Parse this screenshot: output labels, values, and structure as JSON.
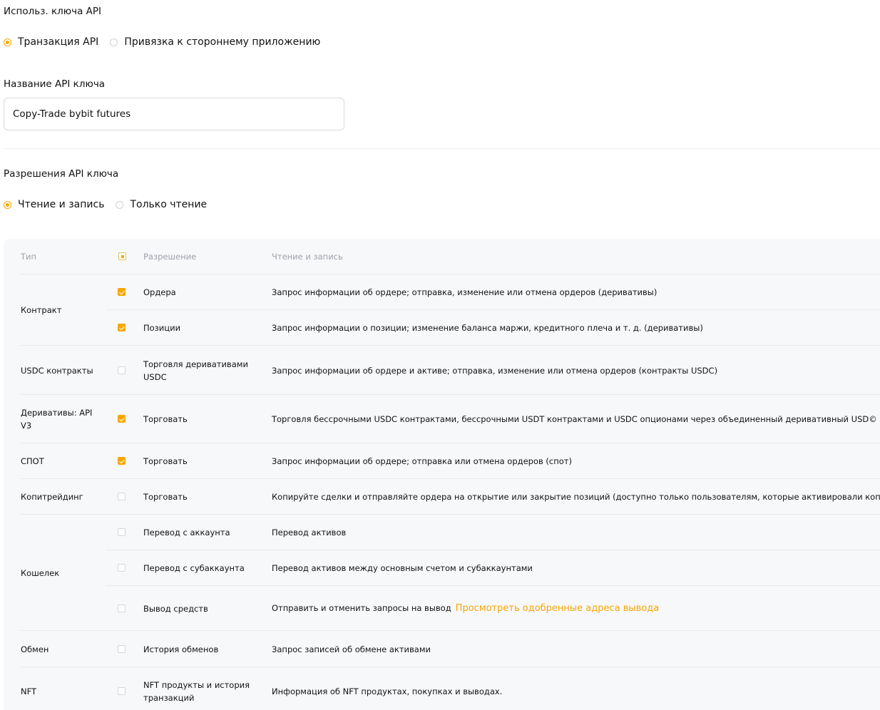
{
  "usage": {
    "label": "Использ. ключа API",
    "options": [
      {
        "label": "Транзакция API",
        "selected": true
      },
      {
        "label": "Привязка к стороннему приложению",
        "selected": false
      }
    ]
  },
  "name_field": {
    "label": "Название API ключа",
    "value": "Copy-Trade bybit futures"
  },
  "permissions": {
    "label": "Разрешения API ключа",
    "options": [
      {
        "label": "Чтение и запись",
        "selected": true
      },
      {
        "label": "Только чтение",
        "selected": false
      }
    ]
  },
  "table": {
    "headers": {
      "type": "Тип",
      "permission": "Разрешение",
      "rw": "Чтение и запись"
    },
    "types": {
      "contract": "Контракт",
      "usdc": "USDC контракты",
      "deriv": "Деривативы: API V3",
      "spot": "СПОТ",
      "copy": "Копитрейдинг",
      "wallet": "Кошелек",
      "exchange": "Обмен",
      "nft": "NFT"
    },
    "rows": [
      {
        "perm": "Ордера",
        "desc": "Запрос информации об ордере; отправка, изменение или отмена ордеров (деривативы)",
        "checked": true
      },
      {
        "perm": "Позиции",
        "desc": "Запрос информации о позиции; изменение баланса маржи, кредитного плеча и т. д. (деривативы)",
        "checked": true
      },
      {
        "perm": "Торговля деривативами USDC",
        "desc": "Запрос информации об ордере и активе; отправка, изменение или отмена ордеров (контракты USDC)",
        "checked": false
      },
      {
        "perm": "Торговать",
        "desc": "Торговля бессрочными USDC контрактами, бессрочными USDT контрактами и USDC опционами через объединенный деривативный USD© аккаунт",
        "checked": true
      },
      {
        "perm": "Торговать",
        "desc": "Запрос информации об ордере; отправка или отмена ордеров (спот)",
        "checked": true
      },
      {
        "perm": "Торговать",
        "desc": "Копируйте сделки и отправляйте ордера на открытие или закрытие позиций (доступно только пользователям, которые активировали копитрейдинг)",
        "checked": false
      },
      {
        "perm": "Перевод с аккаунта",
        "desc": "Перевод активов",
        "checked": false
      },
      {
        "perm": "Перевод с субаккаунта",
        "desc": "Перевод активов между основным счетом и субаккаунтами",
        "checked": false
      },
      {
        "perm": "Вывод средств",
        "desc": "Отправить и отменить запросы на вывод",
        "checked": false,
        "link": "Просмотреть одобренные адреса вывода"
      },
      {
        "perm": "История обменов",
        "desc": "Запрос записей об обмене активами",
        "checked": false
      },
      {
        "perm": "NFT продукты и история транзакций",
        "desc": "Информация об NFT продуктах, покупках и выводах.",
        "checked": false
      }
    ]
  },
  "colors": {
    "accent": "#f7a600",
    "panel_bg": "#f7f8fa"
  }
}
